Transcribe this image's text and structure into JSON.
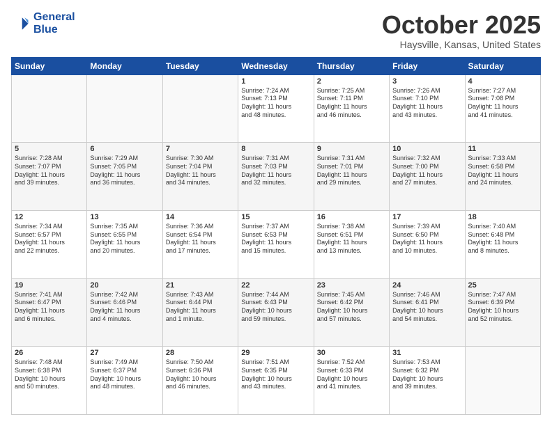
{
  "header": {
    "logo_line1": "General",
    "logo_line2": "Blue",
    "month": "October 2025",
    "location": "Haysville, Kansas, United States"
  },
  "weekdays": [
    "Sunday",
    "Monday",
    "Tuesday",
    "Wednesday",
    "Thursday",
    "Friday",
    "Saturday"
  ],
  "weeks": [
    [
      {
        "day": "",
        "info": ""
      },
      {
        "day": "",
        "info": ""
      },
      {
        "day": "",
        "info": ""
      },
      {
        "day": "1",
        "info": "Sunrise: 7:24 AM\nSunset: 7:13 PM\nDaylight: 11 hours\nand 48 minutes."
      },
      {
        "day": "2",
        "info": "Sunrise: 7:25 AM\nSunset: 7:11 PM\nDaylight: 11 hours\nand 46 minutes."
      },
      {
        "day": "3",
        "info": "Sunrise: 7:26 AM\nSunset: 7:10 PM\nDaylight: 11 hours\nand 43 minutes."
      },
      {
        "day": "4",
        "info": "Sunrise: 7:27 AM\nSunset: 7:08 PM\nDaylight: 11 hours\nand 41 minutes."
      }
    ],
    [
      {
        "day": "5",
        "info": "Sunrise: 7:28 AM\nSunset: 7:07 PM\nDaylight: 11 hours\nand 39 minutes."
      },
      {
        "day": "6",
        "info": "Sunrise: 7:29 AM\nSunset: 7:05 PM\nDaylight: 11 hours\nand 36 minutes."
      },
      {
        "day": "7",
        "info": "Sunrise: 7:30 AM\nSunset: 7:04 PM\nDaylight: 11 hours\nand 34 minutes."
      },
      {
        "day": "8",
        "info": "Sunrise: 7:31 AM\nSunset: 7:03 PM\nDaylight: 11 hours\nand 32 minutes."
      },
      {
        "day": "9",
        "info": "Sunrise: 7:31 AM\nSunset: 7:01 PM\nDaylight: 11 hours\nand 29 minutes."
      },
      {
        "day": "10",
        "info": "Sunrise: 7:32 AM\nSunset: 7:00 PM\nDaylight: 11 hours\nand 27 minutes."
      },
      {
        "day": "11",
        "info": "Sunrise: 7:33 AM\nSunset: 6:58 PM\nDaylight: 11 hours\nand 24 minutes."
      }
    ],
    [
      {
        "day": "12",
        "info": "Sunrise: 7:34 AM\nSunset: 6:57 PM\nDaylight: 11 hours\nand 22 minutes."
      },
      {
        "day": "13",
        "info": "Sunrise: 7:35 AM\nSunset: 6:55 PM\nDaylight: 11 hours\nand 20 minutes."
      },
      {
        "day": "14",
        "info": "Sunrise: 7:36 AM\nSunset: 6:54 PM\nDaylight: 11 hours\nand 17 minutes."
      },
      {
        "day": "15",
        "info": "Sunrise: 7:37 AM\nSunset: 6:53 PM\nDaylight: 11 hours\nand 15 minutes."
      },
      {
        "day": "16",
        "info": "Sunrise: 7:38 AM\nSunset: 6:51 PM\nDaylight: 11 hours\nand 13 minutes."
      },
      {
        "day": "17",
        "info": "Sunrise: 7:39 AM\nSunset: 6:50 PM\nDaylight: 11 hours\nand 10 minutes."
      },
      {
        "day": "18",
        "info": "Sunrise: 7:40 AM\nSunset: 6:48 PM\nDaylight: 11 hours\nand 8 minutes."
      }
    ],
    [
      {
        "day": "19",
        "info": "Sunrise: 7:41 AM\nSunset: 6:47 PM\nDaylight: 11 hours\nand 6 minutes."
      },
      {
        "day": "20",
        "info": "Sunrise: 7:42 AM\nSunset: 6:46 PM\nDaylight: 11 hours\nand 4 minutes."
      },
      {
        "day": "21",
        "info": "Sunrise: 7:43 AM\nSunset: 6:44 PM\nDaylight: 11 hours\nand 1 minute."
      },
      {
        "day": "22",
        "info": "Sunrise: 7:44 AM\nSunset: 6:43 PM\nDaylight: 10 hours\nand 59 minutes."
      },
      {
        "day": "23",
        "info": "Sunrise: 7:45 AM\nSunset: 6:42 PM\nDaylight: 10 hours\nand 57 minutes."
      },
      {
        "day": "24",
        "info": "Sunrise: 7:46 AM\nSunset: 6:41 PM\nDaylight: 10 hours\nand 54 minutes."
      },
      {
        "day": "25",
        "info": "Sunrise: 7:47 AM\nSunset: 6:39 PM\nDaylight: 10 hours\nand 52 minutes."
      }
    ],
    [
      {
        "day": "26",
        "info": "Sunrise: 7:48 AM\nSunset: 6:38 PM\nDaylight: 10 hours\nand 50 minutes."
      },
      {
        "day": "27",
        "info": "Sunrise: 7:49 AM\nSunset: 6:37 PM\nDaylight: 10 hours\nand 48 minutes."
      },
      {
        "day": "28",
        "info": "Sunrise: 7:50 AM\nSunset: 6:36 PM\nDaylight: 10 hours\nand 46 minutes."
      },
      {
        "day": "29",
        "info": "Sunrise: 7:51 AM\nSunset: 6:35 PM\nDaylight: 10 hours\nand 43 minutes."
      },
      {
        "day": "30",
        "info": "Sunrise: 7:52 AM\nSunset: 6:33 PM\nDaylight: 10 hours\nand 41 minutes."
      },
      {
        "day": "31",
        "info": "Sunrise: 7:53 AM\nSunset: 6:32 PM\nDaylight: 10 hours\nand 39 minutes."
      },
      {
        "day": "",
        "info": ""
      }
    ]
  ]
}
